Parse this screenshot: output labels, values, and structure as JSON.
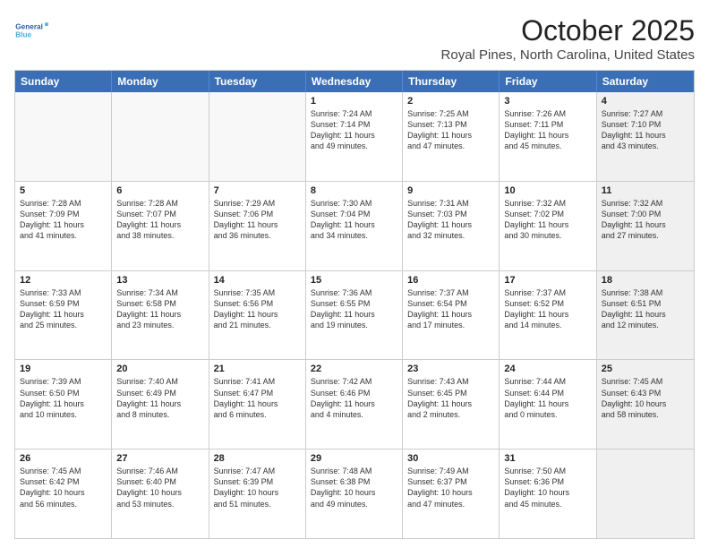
{
  "logo": {
    "line1": "General",
    "line2": "Blue"
  },
  "title": "October 2025",
  "location": "Royal Pines, North Carolina, United States",
  "dayHeaders": [
    "Sunday",
    "Monday",
    "Tuesday",
    "Wednesday",
    "Thursday",
    "Friday",
    "Saturday"
  ],
  "weeks": [
    [
      {
        "num": "",
        "info": "",
        "empty": true
      },
      {
        "num": "",
        "info": "",
        "empty": true
      },
      {
        "num": "",
        "info": "",
        "empty": true
      },
      {
        "num": "1",
        "info": "Sunrise: 7:24 AM\nSunset: 7:14 PM\nDaylight: 11 hours\nand 49 minutes."
      },
      {
        "num": "2",
        "info": "Sunrise: 7:25 AM\nSunset: 7:13 PM\nDaylight: 11 hours\nand 47 minutes."
      },
      {
        "num": "3",
        "info": "Sunrise: 7:26 AM\nSunset: 7:11 PM\nDaylight: 11 hours\nand 45 minutes."
      },
      {
        "num": "4",
        "info": "Sunrise: 7:27 AM\nSunset: 7:10 PM\nDaylight: 11 hours\nand 43 minutes.",
        "shaded": true
      }
    ],
    [
      {
        "num": "5",
        "info": "Sunrise: 7:28 AM\nSunset: 7:09 PM\nDaylight: 11 hours\nand 41 minutes."
      },
      {
        "num": "6",
        "info": "Sunrise: 7:28 AM\nSunset: 7:07 PM\nDaylight: 11 hours\nand 38 minutes."
      },
      {
        "num": "7",
        "info": "Sunrise: 7:29 AM\nSunset: 7:06 PM\nDaylight: 11 hours\nand 36 minutes."
      },
      {
        "num": "8",
        "info": "Sunrise: 7:30 AM\nSunset: 7:04 PM\nDaylight: 11 hours\nand 34 minutes."
      },
      {
        "num": "9",
        "info": "Sunrise: 7:31 AM\nSunset: 7:03 PM\nDaylight: 11 hours\nand 32 minutes."
      },
      {
        "num": "10",
        "info": "Sunrise: 7:32 AM\nSunset: 7:02 PM\nDaylight: 11 hours\nand 30 minutes."
      },
      {
        "num": "11",
        "info": "Sunrise: 7:32 AM\nSunset: 7:00 PM\nDaylight: 11 hours\nand 27 minutes.",
        "shaded": true
      }
    ],
    [
      {
        "num": "12",
        "info": "Sunrise: 7:33 AM\nSunset: 6:59 PM\nDaylight: 11 hours\nand 25 minutes."
      },
      {
        "num": "13",
        "info": "Sunrise: 7:34 AM\nSunset: 6:58 PM\nDaylight: 11 hours\nand 23 minutes."
      },
      {
        "num": "14",
        "info": "Sunrise: 7:35 AM\nSunset: 6:56 PM\nDaylight: 11 hours\nand 21 minutes."
      },
      {
        "num": "15",
        "info": "Sunrise: 7:36 AM\nSunset: 6:55 PM\nDaylight: 11 hours\nand 19 minutes."
      },
      {
        "num": "16",
        "info": "Sunrise: 7:37 AM\nSunset: 6:54 PM\nDaylight: 11 hours\nand 17 minutes."
      },
      {
        "num": "17",
        "info": "Sunrise: 7:37 AM\nSunset: 6:52 PM\nDaylight: 11 hours\nand 14 minutes."
      },
      {
        "num": "18",
        "info": "Sunrise: 7:38 AM\nSunset: 6:51 PM\nDaylight: 11 hours\nand 12 minutes.",
        "shaded": true
      }
    ],
    [
      {
        "num": "19",
        "info": "Sunrise: 7:39 AM\nSunset: 6:50 PM\nDaylight: 11 hours\nand 10 minutes."
      },
      {
        "num": "20",
        "info": "Sunrise: 7:40 AM\nSunset: 6:49 PM\nDaylight: 11 hours\nand 8 minutes."
      },
      {
        "num": "21",
        "info": "Sunrise: 7:41 AM\nSunset: 6:47 PM\nDaylight: 11 hours\nand 6 minutes."
      },
      {
        "num": "22",
        "info": "Sunrise: 7:42 AM\nSunset: 6:46 PM\nDaylight: 11 hours\nand 4 minutes."
      },
      {
        "num": "23",
        "info": "Sunrise: 7:43 AM\nSunset: 6:45 PM\nDaylight: 11 hours\nand 2 minutes."
      },
      {
        "num": "24",
        "info": "Sunrise: 7:44 AM\nSunset: 6:44 PM\nDaylight: 11 hours\nand 0 minutes."
      },
      {
        "num": "25",
        "info": "Sunrise: 7:45 AM\nSunset: 6:43 PM\nDaylight: 10 hours\nand 58 minutes.",
        "shaded": true
      }
    ],
    [
      {
        "num": "26",
        "info": "Sunrise: 7:45 AM\nSunset: 6:42 PM\nDaylight: 10 hours\nand 56 minutes."
      },
      {
        "num": "27",
        "info": "Sunrise: 7:46 AM\nSunset: 6:40 PM\nDaylight: 10 hours\nand 53 minutes."
      },
      {
        "num": "28",
        "info": "Sunrise: 7:47 AM\nSunset: 6:39 PM\nDaylight: 10 hours\nand 51 minutes."
      },
      {
        "num": "29",
        "info": "Sunrise: 7:48 AM\nSunset: 6:38 PM\nDaylight: 10 hours\nand 49 minutes."
      },
      {
        "num": "30",
        "info": "Sunrise: 7:49 AM\nSunset: 6:37 PM\nDaylight: 10 hours\nand 47 minutes."
      },
      {
        "num": "31",
        "info": "Sunrise: 7:50 AM\nSunset: 6:36 PM\nDaylight: 10 hours\nand 45 minutes."
      },
      {
        "num": "",
        "info": "",
        "empty": true,
        "shaded": true
      }
    ]
  ]
}
